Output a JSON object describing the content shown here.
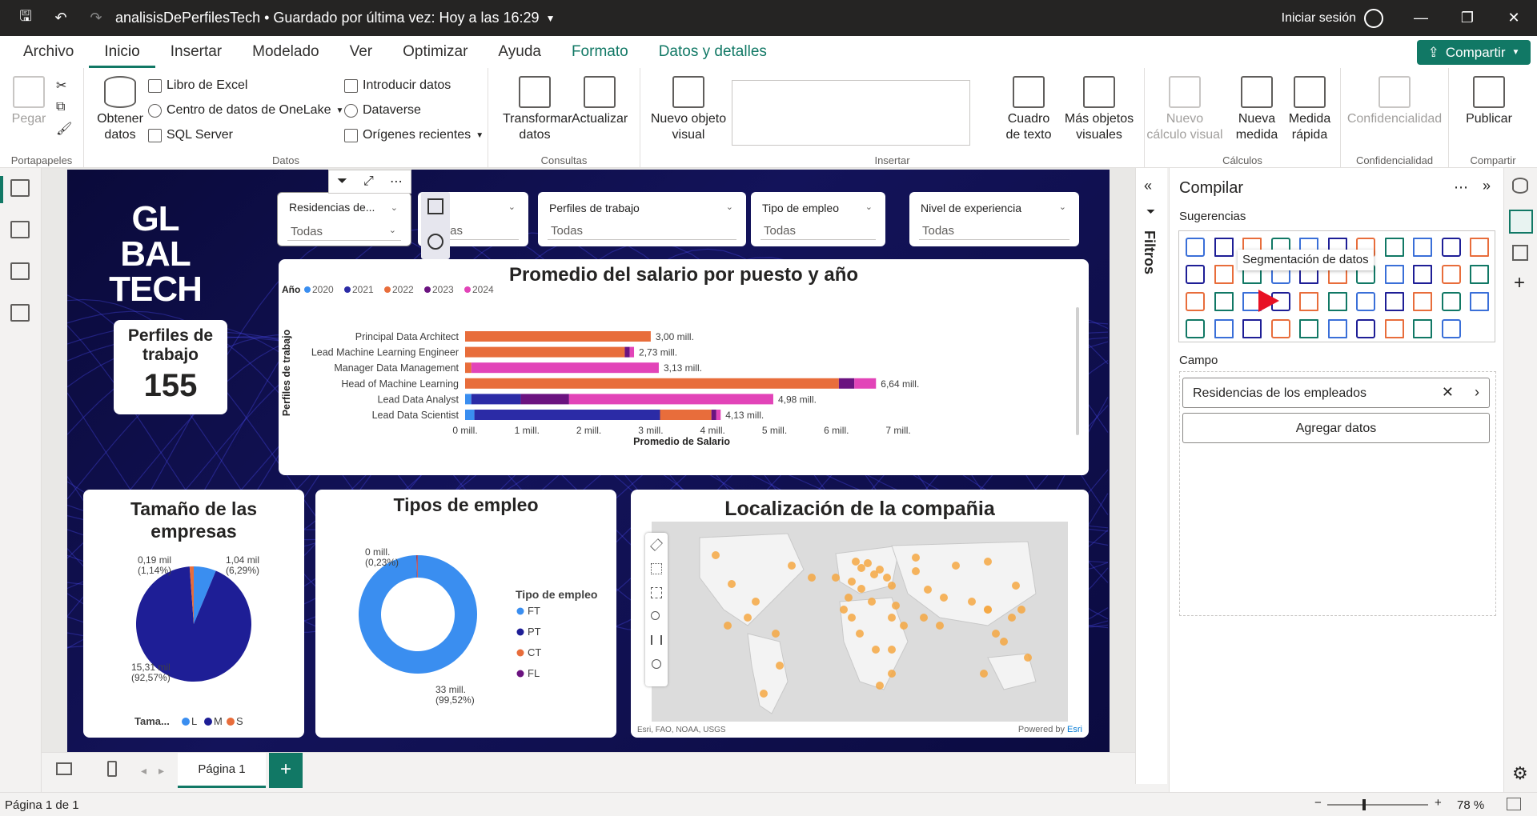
{
  "titlebar": {
    "file": "analisisDePerfilesTech • Guardado por última vez: Hoy a las 16:29",
    "signin": "Iniciar sesión"
  },
  "menu": {
    "items": [
      "Archivo",
      "Inicio",
      "Insertar",
      "Modelado",
      "Ver",
      "Optimizar",
      "Ayuda",
      "Formato",
      "Datos y detalles"
    ],
    "share": "Compartir"
  },
  "ribbon": {
    "paste": "Pegar",
    "clipboard": "Portapapeles",
    "get_data": "Obtener datos",
    "excel": "Libro de Excel",
    "onelake": "Centro de datos de OneLake",
    "sql": "SQL Server",
    "enter_data": "Introducir datos",
    "dataverse": "Dataverse",
    "recent": "Orígenes recientes",
    "data_group": "Datos",
    "transform": "Transformar datos",
    "refresh": "Actualizar",
    "queries_group": "Consultas",
    "new_visual": "Nuevo objeto visual",
    "textbox": "Cuadro de texto",
    "more_visuals": "Más objetos visuales",
    "insert_group": "Insertar",
    "new_calc": "Nuevo cálculo visual",
    "new_measure": "Nueva medida",
    "quick_measure": "Medida rápida",
    "calc_group": "Cálculos",
    "sensitivity": "Confidencialidad",
    "sensitivity_group": "Confidencialidad",
    "publish": "Publicar",
    "share_group": "Compartir"
  },
  "report": {
    "logo_line1": "GL  BAL",
    "logo_line2": "TECH",
    "kpi_title": "Perfiles de trabajo",
    "kpi_value": "155",
    "slicers": [
      {
        "label": "Residencias de...",
        "value": "Todas"
      },
      {
        "label": "",
        "value": "Todas"
      },
      {
        "label": "Perfiles de trabajo",
        "value": "Todas"
      },
      {
        "label": "Tipo de empleo",
        "value": "Todas"
      },
      {
        "label": "Nivel de experiencia",
        "value": "Todas"
      }
    ],
    "bar_title": "Promedio del salario por puesto y año",
    "pie_title": "Tamaño de las empresas",
    "donut_title": "Tipos de empleo",
    "map_title": "Localización de la compañia",
    "map_credit": "Esri, FAO, NOAA, USGS",
    "map_powered": "Powered by",
    "map_esri": "Esri"
  },
  "chart_data": [
    {
      "type": "bar",
      "title": "Promedio del salario por puesto y año",
      "legend_title": "Año",
      "legend": [
        "2020",
        "2021",
        "2022",
        "2023",
        "2024"
      ],
      "colors": [
        "#3a8ef0",
        "#2b2ba6",
        "#e86d3b",
        "#6b1380",
        "#e244b8"
      ],
      "categories": [
        "Principal Data Architect",
        "Lead Machine Learning Engineer",
        "Manager Data Management",
        "Head of Machine Learning",
        "Lead Data Analyst",
        "Lead Data Scientist"
      ],
      "series": [
        {
          "name": "2020",
          "values": [
            0,
            0,
            0,
            0,
            0.1,
            0.15
          ]
        },
        {
          "name": "2021",
          "values": [
            0,
            0,
            0,
            0,
            0.8,
            3.0
          ]
        },
        {
          "name": "2022",
          "values": [
            3.0,
            2.58,
            0.1,
            6.04,
            0,
            0.83
          ]
        },
        {
          "name": "2023",
          "values": [
            0,
            0.08,
            0,
            0.25,
            0.78,
            0.08
          ]
        },
        {
          "name": "2024",
          "values": [
            0,
            0.07,
            3.03,
            0.35,
            3.3,
            0.07
          ]
        }
      ],
      "totals": [
        "3,00 mill.",
        "2,73 mill.",
        "3,13 mill.",
        "6,64 mill.",
        "4,98 mill.",
        "4,13 mill."
      ],
      "xticks": [
        "0 mill.",
        "1 mill.",
        "2 mill.",
        "3 mill.",
        "4 mill.",
        "5 mill.",
        "6 mill.",
        "7 mill."
      ],
      "xlabel": "Promedio de Salario",
      "ylabel": "Perfiles de trabajo",
      "xlim": [
        0,
        7
      ]
    },
    {
      "type": "pie",
      "title": "Tamaño de las empresas",
      "legend_title": "Tama...",
      "labels": [
        "L",
        "M",
        "S"
      ],
      "colors": [
        "#3a8ef0",
        "#1e1e96",
        "#e86d3b"
      ],
      "values": [
        1.04,
        15.31,
        0.19
      ],
      "data_labels": [
        "1,04 mil\n(6,29%)",
        "15,31 mil\n(92,57%)",
        "0,19 mil\n(1,14%)"
      ]
    },
    {
      "type": "pie",
      "subtype": "donut",
      "title": "Tipos de empleo",
      "legend_title": "Tipo de empleo",
      "labels": [
        "FT",
        "PT",
        "CT",
        "FL"
      ],
      "colors": [
        "#3a8ef0",
        "#1e1e96",
        "#e86d3b",
        "#6b1380"
      ],
      "values": [
        33,
        0.04,
        0.08,
        0.03
      ],
      "data_labels": [
        "33 mill.\n(99,52%)",
        "0 mill.\n(0,23%)"
      ]
    }
  ],
  "filters_label": "Filtros",
  "build": {
    "title": "Compilar",
    "suggestions": "Sugerencias",
    "tooltip": "Segmentación de datos",
    "field_label": "Campo",
    "field_value": "Residencias de los empleados",
    "add_data": "Agregar datos"
  },
  "tabs": {
    "page": "Página 1",
    "add": "+"
  },
  "status": {
    "page": "Página 1 de 1",
    "zoom": "78 %"
  }
}
